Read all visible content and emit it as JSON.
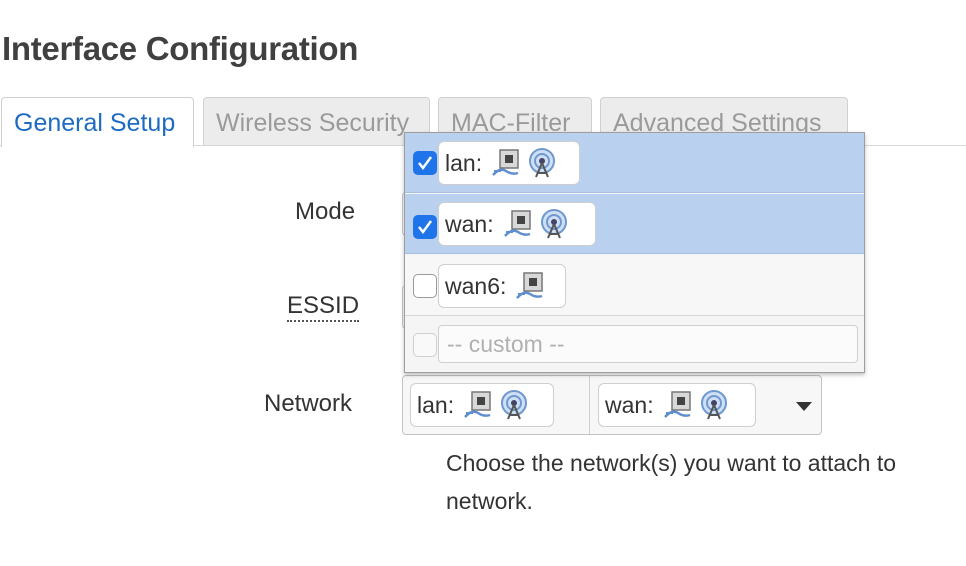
{
  "page": {
    "title": "Interface Configuration"
  },
  "tabs": [
    {
      "label": "General Setup",
      "active": true
    },
    {
      "label": "Wireless Security",
      "active": false
    },
    {
      "label": "MAC-Filter",
      "active": false
    },
    {
      "label": "Advanced Settings",
      "active": false
    }
  ],
  "form": {
    "mode_label": "Mode",
    "essid_label": "ESSID",
    "network_label": "Network",
    "network_help": "Choose the network(s) you want to attach to network."
  },
  "network_select": {
    "selected": [
      {
        "label": "lan:",
        "icons": [
          "ethernet-port-icon",
          "wifi-antenna-icon"
        ]
      },
      {
        "label": "wan:",
        "icons": [
          "ethernet-port-icon",
          "wifi-antenna-icon"
        ]
      }
    ]
  },
  "dropdown": {
    "options": [
      {
        "label": "lan:",
        "checked": true,
        "icons": [
          "ethernet-port-icon",
          "wifi-antenna-icon"
        ]
      },
      {
        "label": "wan:",
        "checked": true,
        "icons": [
          "ethernet-port-icon",
          "wifi-antenna-icon"
        ]
      },
      {
        "label": "wan6:",
        "checked": false,
        "icons": [
          "ethernet-port-icon"
        ]
      }
    ],
    "custom_placeholder": "-- custom --"
  },
  "colors": {
    "accent": "#1e6bc4",
    "selected_row": "#b9d1ef",
    "checkbox": "#1e74e8"
  }
}
